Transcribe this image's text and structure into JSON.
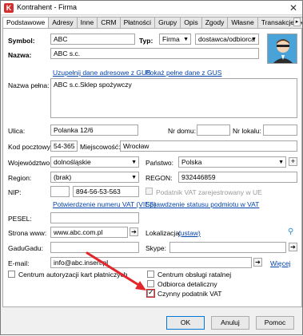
{
  "window": {
    "title": "Kontrahent - Firma",
    "icon_letter": "K"
  },
  "tabs": [
    "Podstawowe",
    "Adresy",
    "Inne",
    "CRM",
    "Płatności",
    "Grupy",
    "Opis",
    "Zgody",
    "Własne",
    "Transakcje jed"
  ],
  "form": {
    "symbol_label": "Symbol:",
    "symbol_value": "ABC",
    "typ_label": "Typ:",
    "typ_value": "Firma",
    "role_value": "dostawca/odbiorca",
    "nazwa_label": "Nazwa:",
    "nazwa_value": "ABC s.c.",
    "gus_update_link": "Uzupełnij dane adresowe z GUS",
    "gus_full_link": "Pokaż pełne dane z GUS",
    "nazwa_pelna_label": "Nazwa pełna:",
    "nazwa_pelna_value": "ABC s.c.Sklep spożywczy",
    "ulica_label": "Ulica:",
    "ulica_value": "Polanka 12/6",
    "nr_domu_label": "Nr domu:",
    "nr_domu_value": "",
    "nr_lokalu_label": "Nr lokalu:",
    "nr_lokalu_value": "",
    "kod_label": "Kod pocztowy:",
    "kod_value": "54-365",
    "miejscowosc_label": "Miejscowość:",
    "miejscowosc_value": "Wrocław",
    "wojewodztwo_label": "Województwo:",
    "wojewodztwo_value": "dolnośląskie",
    "panstwo_label": "Państwo:",
    "panstwo_value": "Polska",
    "region_label": "Region:",
    "region_value": "(brak)",
    "regon_label": "REGON:",
    "regon_value": "932446859",
    "nip_label": "NIP:",
    "nip_prefix": "",
    "nip_value": "894-56-53-563",
    "vat_ue_label": "Podatnik VAT zarejestrowany w UE",
    "vies_link": "Potwierdzenie numeru VAT (VIES)",
    "vat_status_link": "Sprawdzenie statusu podmiotu w VAT",
    "pesel_label": "PESEL:",
    "pesel_value": "",
    "www_label": "Strona www:",
    "www_value": "www.abc.com.pl",
    "lokalizacja_label": "Lokalizacja:",
    "lokalizacja_link": "(ustaw)",
    "gadugadu_label": "GaduGadu:",
    "gadugadu_value": "",
    "skype_label": "Skype:",
    "skype_value": "",
    "email_label": "E-mail:",
    "email_value": "info@abc.insert.pl",
    "wiecej_link": "Więcej",
    "checkboxes": {
      "centrum_kart": "Centrum autoryzacji kart płatniczych",
      "centrum_ratalne": "Centrum obsługi ratalnej",
      "odbiorca_detaliczny": "Odbiorca detaliczny",
      "czynny_vat": "Czynny podatnik VAT"
    }
  },
  "buttons": {
    "ok": "OK",
    "anuluj": "Anuluj",
    "pomoc": "Pomoc"
  },
  "colors": {
    "arrow": "#e3262b",
    "link": "#0645ad",
    "avatar_bg": "#4aa3d8"
  }
}
